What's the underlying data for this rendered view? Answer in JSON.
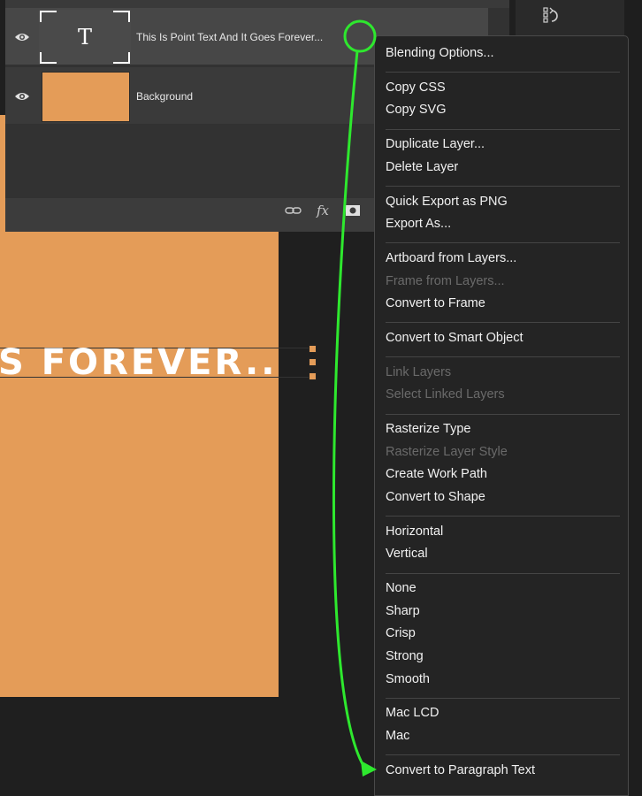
{
  "layers_panel": {
    "layers": [
      {
        "name": "This Is Point Text And It Goes Forever...",
        "type": "text",
        "thumb_glyph": "T"
      },
      {
        "name": "Background",
        "type": "fill"
      }
    ],
    "footer_icons": [
      "link-icon",
      "fx-icon",
      "mask-icon"
    ],
    "fx_label": "fx"
  },
  "canvas": {
    "visible_text": "S FOREVER..",
    "background_color": "#e49c58",
    "text_color": "#ffffff"
  },
  "context_menu": {
    "groups": [
      [
        {
          "label": "Blending Options...",
          "enabled": true
        }
      ],
      [
        {
          "label": "Copy CSS",
          "enabled": true
        },
        {
          "label": "Copy SVG",
          "enabled": true
        }
      ],
      [
        {
          "label": "Duplicate Layer...",
          "enabled": true
        },
        {
          "label": "Delete Layer",
          "enabled": true
        }
      ],
      [
        {
          "label": "Quick Export as PNG",
          "enabled": true
        },
        {
          "label": "Export As...",
          "enabled": true
        }
      ],
      [
        {
          "label": "Artboard from Layers...",
          "enabled": true
        },
        {
          "label": "Frame from Layers...",
          "enabled": false
        },
        {
          "label": "Convert to Frame",
          "enabled": true
        }
      ],
      [
        {
          "label": "Convert to Smart Object",
          "enabled": true
        }
      ],
      [
        {
          "label": "Link Layers",
          "enabled": false
        },
        {
          "label": "Select Linked Layers",
          "enabled": false
        }
      ],
      [
        {
          "label": "Rasterize Type",
          "enabled": true
        },
        {
          "label": "Rasterize Layer Style",
          "enabled": false
        },
        {
          "label": "Create Work Path",
          "enabled": true
        },
        {
          "label": "Convert to Shape",
          "enabled": true
        }
      ],
      [
        {
          "label": "Horizontal",
          "enabled": true
        },
        {
          "label": "Vertical",
          "enabled": true
        }
      ],
      [
        {
          "label": "None",
          "enabled": true
        },
        {
          "label": "Sharp",
          "enabled": true
        },
        {
          "label": "Crisp",
          "enabled": true
        },
        {
          "label": "Strong",
          "enabled": true
        },
        {
          "label": "Smooth",
          "enabled": true
        }
      ],
      [
        {
          "label": "Mac LCD",
          "enabled": true
        },
        {
          "label": "Mac",
          "enabled": true
        }
      ],
      [
        {
          "label": "Convert to Paragraph Text",
          "enabled": true
        }
      ]
    ]
  },
  "annotation": {
    "color": "#2ee82e"
  },
  "colors": {
    "accent_orange": "#e49c58",
    "highlight_green": "#2ee82e",
    "menu_bg": "#242424"
  }
}
